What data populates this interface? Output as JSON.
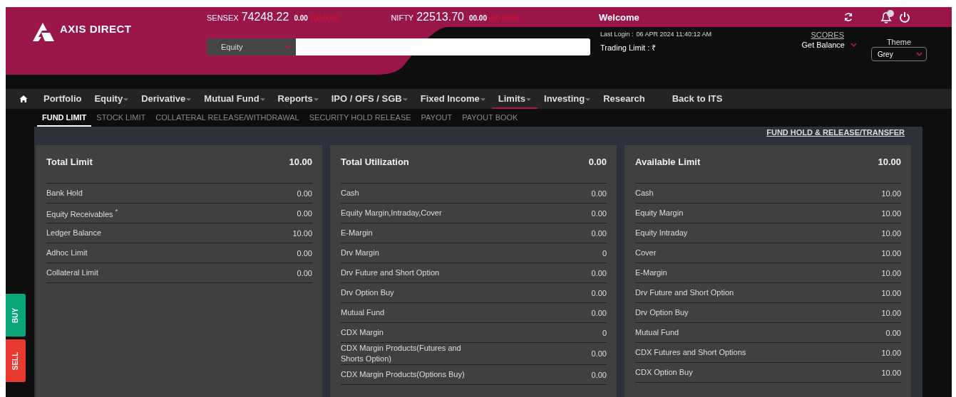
{
  "brand": {
    "name": "AXIS DIRECT"
  },
  "ticker": [
    {
      "name": "SENSEX",
      "value": "74248.22",
      "change": "0.00",
      "percent": "(00.00%)"
    },
    {
      "name": "NIFTY",
      "value": "22513.70",
      "change": "00.00",
      "percent": "(00.00%)"
    }
  ],
  "search": {
    "segment": "Equity"
  },
  "welcome": {
    "title": "Welcome",
    "last_login_label": "Last Login :",
    "last_login": "06 APR 2024 11:40:12 AM",
    "trading_limit": "Trading Limit : ₹",
    "scores": "SCORES",
    "get_balance": "Get Balance",
    "theme_label": "Theme",
    "theme": "Grey",
    "notification": true
  },
  "nav": [
    {
      "label": "Portfolio",
      "dropdown": false,
      "selected": false
    },
    {
      "label": "Equity",
      "dropdown": true,
      "selected": false
    },
    {
      "label": "Derivative",
      "dropdown": true,
      "selected": false
    },
    {
      "label": "Mutual Fund",
      "dropdown": true,
      "selected": false
    },
    {
      "label": "Reports",
      "dropdown": true,
      "selected": false
    },
    {
      "label": "IPO / OFS / SGB",
      "dropdown": true,
      "selected": false
    },
    {
      "label": "Fixed Income",
      "dropdown": true,
      "selected": false
    },
    {
      "label": "Limits",
      "dropdown": true,
      "selected": true
    },
    {
      "label": "Investing",
      "dropdown": true,
      "selected": false
    },
    {
      "label": "Research",
      "dropdown": false,
      "selected": false
    },
    {
      "label": "Back to ITS",
      "dropdown": false,
      "selected": false
    }
  ],
  "subtabs": [
    {
      "label": "FUND LIMIT",
      "selected": true
    },
    {
      "label": "STOCK LIMIT",
      "selected": false
    },
    {
      "label": "COLLATERAL RELEASE/WITHDRAWAL",
      "selected": false
    },
    {
      "label": "SECURITY HOLD RELEASE",
      "selected": false
    },
    {
      "label": "PAYOUT",
      "selected": false
    },
    {
      "label": "PAYOUT BOOK",
      "selected": false
    }
  ],
  "fund_hold_link": "FUND HOLD & RELEASE/TRANSFER",
  "cards": [
    {
      "title": "Total Limit",
      "total": "10.00",
      "rows": [
        {
          "label": "Bank Hold",
          "value": "0.00"
        },
        {
          "label": "Equity Receivables $^{*}$",
          "value": "0.00"
        },
        {
          "label": "Ledger Balance",
          "value": "10.00"
        },
        {
          "label": "Adhoc Limit",
          "value": "0.00"
        },
        {
          "label": "Collateral Limit",
          "value": "0.00"
        }
      ]
    },
    {
      "title": "Total Utilization",
      "total": "0.00",
      "rows": [
        {
          "label": "Cash",
          "value": "0.00"
        },
        {
          "label": "Equity Margin,Intraday,Cover",
          "value": "0.00"
        },
        {
          "label": "E-Margin",
          "value": "0.00"
        },
        {
          "label": "Drv Margin",
          "value": "0"
        },
        {
          "label": "Drv Future and Short Option",
          "value": "0.00"
        },
        {
          "label": "Drv Option Buy",
          "value": "0.00"
        },
        {
          "label": "Mutual Fund",
          "value": "0.00"
        },
        {
          "label": "CDX Margin",
          "value": "0"
        },
        {
          "label": "CDX Margin Products(Futures and Shorts Option)",
          "value": "0.00"
        },
        {
          "label": "CDX Margin Products(Options Buy)",
          "value": "0.00"
        }
      ]
    },
    {
      "title": "Available Limit",
      "total": "10.00",
      "rows": [
        {
          "label": "Cash",
          "value": "10.00"
        },
        {
          "label": "Equity Margin",
          "value": "10.00"
        },
        {
          "label": "Equity Intraday",
          "value": "10.00"
        },
        {
          "label": "Cover",
          "value": "10.00"
        },
        {
          "label": "E-Margin",
          "value": "10.00"
        },
        {
          "label": "Drv Future and Short Option",
          "value": "10.00"
        },
        {
          "label": "Drv Option Buy",
          "value": "10.00"
        },
        {
          "label": "Mutual Fund",
          "value": "0.00"
        },
        {
          "label": "CDX Futures and Short Options",
          "value": "10.00"
        },
        {
          "label": "CDX Option Buy",
          "value": "10.00"
        }
      ]
    }
  ],
  "side_buttons": [
    {
      "label": "BUY",
      "kind": "buy"
    },
    {
      "label": "SELL",
      "kind": "sell"
    }
  ]
}
